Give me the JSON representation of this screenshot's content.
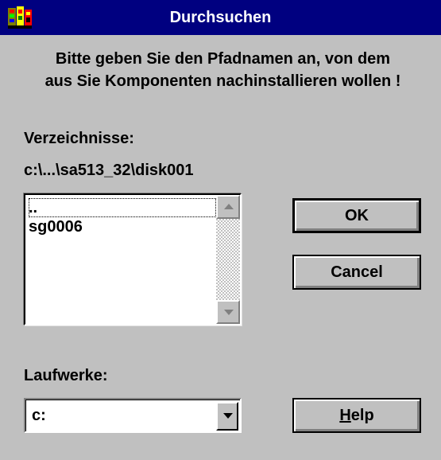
{
  "window": {
    "title": "Durchsuchen",
    "icon": "setup-program-icon"
  },
  "instruction": "Bitte geben Sie den Pfadnamen an, von dem\naus Sie Komponenten nachinstallieren wollen !",
  "directories": {
    "label": "Verzeichnisse:",
    "current_path": "c:\\...\\sa513_32\\disk001",
    "items": [
      "..",
      "sg0006"
    ],
    "selected_index": 0
  },
  "drives": {
    "label": "Laufwerke:",
    "selected": "c:"
  },
  "buttons": {
    "ok": "OK",
    "cancel": "Cancel",
    "help_accel": "H",
    "help_rest": "elp"
  },
  "colors": {
    "face": "#c0c0c0",
    "titlebar": "#000080",
    "title_text": "#ffffff"
  }
}
